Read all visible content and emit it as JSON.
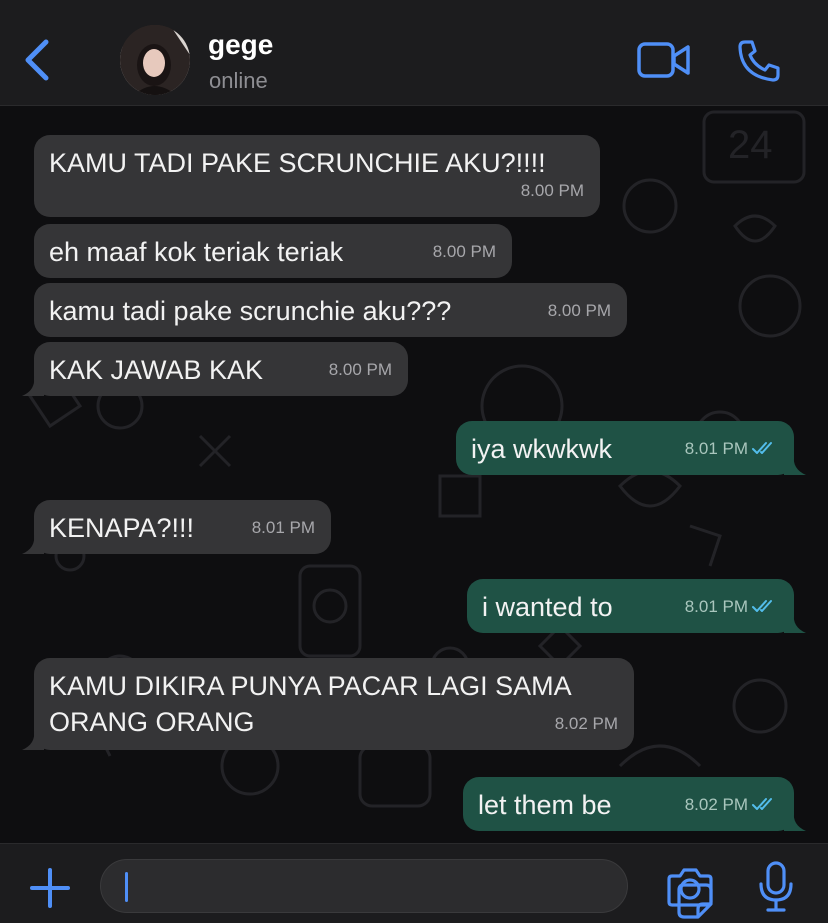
{
  "header": {
    "contact_name": "gege",
    "status": "online",
    "icons": [
      "chevron-left-icon",
      "video-camera-icon",
      "phone-icon"
    ]
  },
  "messages": [
    {
      "direction": "in",
      "text": "KAMU TADI PAKE SCRUNCHIE AKU?!!!!",
      "time": "8.00 PM"
    },
    {
      "direction": "in",
      "text": "eh maaf kok teriak teriak",
      "time": "8.00 PM"
    },
    {
      "direction": "in",
      "text": "kamu tadi pake scrunchie aku???",
      "time": "8.00 PM"
    },
    {
      "direction": "in",
      "text": "KAK JAWAB KAK",
      "time": "8.00 PM"
    },
    {
      "direction": "out",
      "text": "iya wkwkwk",
      "time": "8.01 PM",
      "read": true
    },
    {
      "direction": "in",
      "text": "KENAPA?!!!",
      "time": "8.01 PM"
    },
    {
      "direction": "out",
      "text": "i wanted to",
      "time": "8.01 PM",
      "read": true
    },
    {
      "direction": "in",
      "text_line1": "KAMU DIKIRA PUNYA PACAR LAGI SAMA",
      "text_line2": "ORANG ORANG",
      "time": "8.02 PM"
    },
    {
      "direction": "out",
      "text": "let them be",
      "time": "8.02 PM",
      "read": true
    }
  ],
  "composer": {
    "input_value": "",
    "icons": [
      "plus-icon",
      "sticker-icon",
      "camera-icon",
      "microphone-icon"
    ]
  },
  "colors": {
    "accent": "#4f8ff7",
    "incoming_bubble": "#353537",
    "outgoing_bubble": "#1f5245",
    "read_ticks": "#53bdeb"
  }
}
